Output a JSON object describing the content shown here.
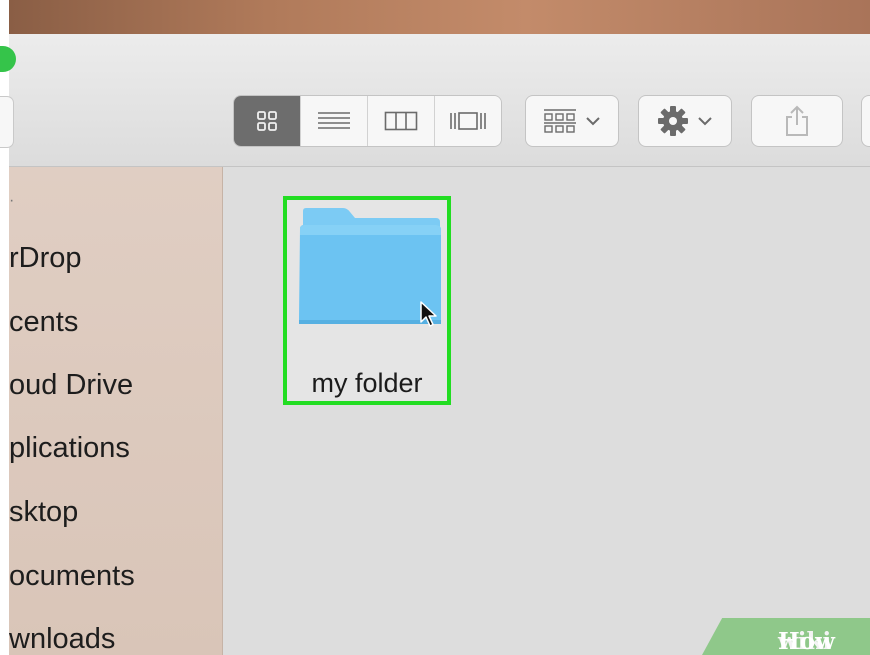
{
  "sidebar": {
    "items": [
      {
        "label": "rDrop"
      },
      {
        "label": "cents"
      },
      {
        "label": "oud Drive"
      },
      {
        "label": "plications"
      },
      {
        "label": "sktop"
      },
      {
        "label": "ocuments"
      },
      {
        "label": "wnloads"
      }
    ]
  },
  "content": {
    "folder": {
      "name": "my folder"
    }
  },
  "toolbar": {
    "view_modes": [
      "icon-view-icon",
      "list-view-icon",
      "column-view-icon",
      "cover-flow-icon"
    ],
    "active_view": "icon-view-icon"
  },
  "colors": {
    "highlight": "#22dd22",
    "folder": "#6cc3f2",
    "sidebar_bg": "#ddcabe",
    "content_bg": "#dddddd"
  },
  "watermark": {
    "part1": "wiki",
    "part2": "How"
  }
}
